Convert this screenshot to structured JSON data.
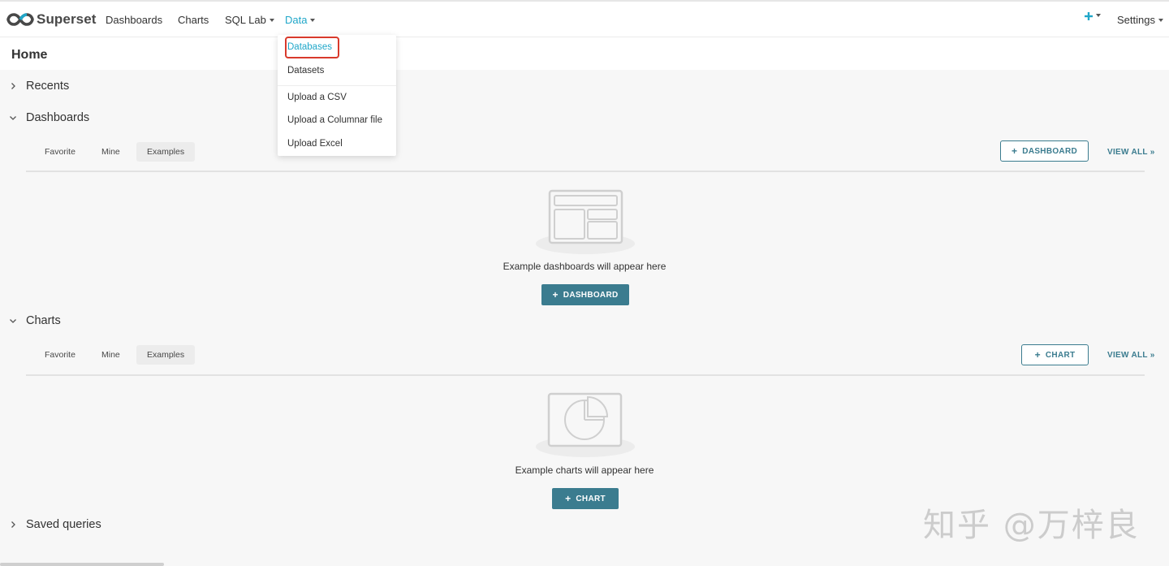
{
  "nav": {
    "brand": "Superset",
    "items": [
      {
        "label": "Dashboards"
      },
      {
        "label": "Charts"
      },
      {
        "label": "SQL Lab"
      },
      {
        "label": "Data"
      }
    ],
    "settings_label": "Settings",
    "plus_icon": "plus-icon"
  },
  "page": {
    "title": "Home"
  },
  "data_menu": {
    "items": [
      "Databases",
      "Datasets",
      "Upload a CSV",
      "Upload a Columnar file",
      "Upload Excel"
    ],
    "highlighted": "Databases"
  },
  "sections": {
    "recents": {
      "title": "Recents",
      "expanded": false
    },
    "dashboards": {
      "title": "Dashboards",
      "expanded": true,
      "tabs": [
        "Favorite",
        "Mine",
        "Examples"
      ],
      "selected_tab": "Examples",
      "add_label": "DASHBOARD",
      "view_all": "VIEW ALL »",
      "empty_text": "Example dashboards will appear here",
      "empty_button": "DASHBOARD"
    },
    "charts": {
      "title": "Charts",
      "expanded": true,
      "tabs": [
        "Favorite",
        "Mine",
        "Examples"
      ],
      "selected_tab": "Examples",
      "add_label": "CHART",
      "view_all": "VIEW ALL »",
      "empty_text": "Example charts will appear here",
      "empty_button": "CHART"
    },
    "saved_queries": {
      "title": "Saved queries",
      "expanded": false
    }
  },
  "watermark": "知乎 @万梓良",
  "colors": {
    "accent": "#20a7c9",
    "primary_button": "#3b7c8f",
    "highlight_box": "#d8392b"
  }
}
